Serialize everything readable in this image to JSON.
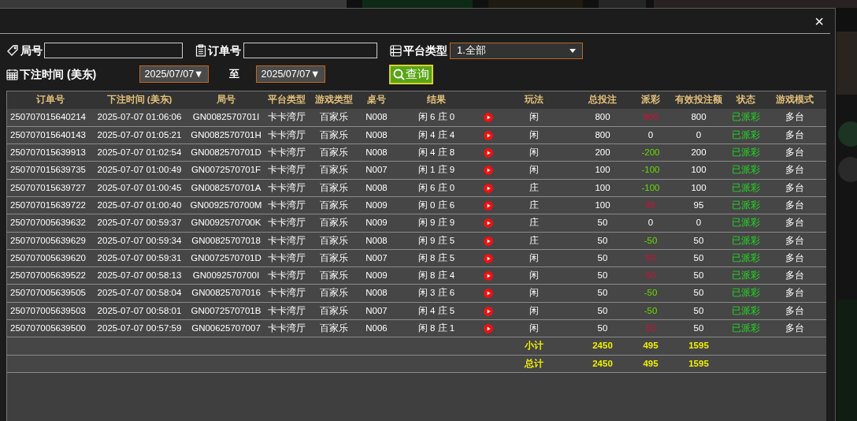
{
  "dialog": {
    "close": "×"
  },
  "filters": {
    "round_no": {
      "label": "局号"
    },
    "order_no": {
      "label": "订单号"
    },
    "platform": {
      "label": "平台类型",
      "value": "1.全部"
    },
    "bet_time": {
      "label": "下注时间 (美东)",
      "from": "2025/07/07▼",
      "separator": "至",
      "to": "2025/07/07▼"
    },
    "search_button": "查询"
  },
  "table": {
    "columns": [
      "订单号",
      "下注时间 (美东)",
      "局号",
      "平台类型",
      "游戏类型",
      "桌号",
      "结果",
      "玩法",
      "总投注",
      "派彩",
      "有效投注额",
      "状态",
      "游戏模式"
    ],
    "rows": [
      {
        "order": "250707015640214",
        "time": "2025-07-07 01:06:06",
        "round": "GN0082570701I",
        "platform": "卡卡湾厅",
        "game": "百家乐",
        "table": "N008",
        "result": "闲 6 庄 0",
        "play": "闲",
        "bet": "800",
        "payout": {
          "text": "800",
          "kind": "positive"
        },
        "valid": "800",
        "status": "已派彩",
        "mode": "多台"
      },
      {
        "order": "250707015640143",
        "time": "2025-07-07 01:05:21",
        "round": "GN0082570701H",
        "platform": "卡卡湾厅",
        "game": "百家乐",
        "table": "N008",
        "result": "闲 4 庄 4",
        "play": "闲",
        "bet": "800",
        "payout": {
          "text": "0",
          "kind": "zero"
        },
        "valid": "0",
        "status": "已派彩",
        "mode": "多台"
      },
      {
        "order": "250707015639913",
        "time": "2025-07-07 01:02:54",
        "round": "GN0082570701D",
        "platform": "卡卡湾厅",
        "game": "百家乐",
        "table": "N008",
        "result": "闲 4 庄 8",
        "play": "闲",
        "bet": "200",
        "payout": {
          "text": "-200",
          "kind": "negative"
        },
        "valid": "200",
        "status": "已派彩",
        "mode": "多台"
      },
      {
        "order": "250707015639735",
        "time": "2025-07-07 01:00:49",
        "round": "GN0072570701F",
        "platform": "卡卡湾厅",
        "game": "百家乐",
        "table": "N007",
        "result": "闲 1 庄 9",
        "play": "闲",
        "bet": "100",
        "payout": {
          "text": "-100",
          "kind": "negative"
        },
        "valid": "100",
        "status": "已派彩",
        "mode": "多台"
      },
      {
        "order": "250707015639727",
        "time": "2025-07-07 01:00:45",
        "round": "GN0082570701A",
        "platform": "卡卡湾厅",
        "game": "百家乐",
        "table": "N008",
        "result": "闲 6 庄 0",
        "play": "庄",
        "bet": "100",
        "payout": {
          "text": "-100",
          "kind": "negative"
        },
        "valid": "100",
        "status": "已派彩",
        "mode": "多台"
      },
      {
        "order": "250707015639722",
        "time": "2025-07-07 01:00:40",
        "round": "GN0092570700M",
        "platform": "卡卡湾厅",
        "game": "百家乐",
        "table": "N009",
        "result": "闲 0 庄 6",
        "play": "庄",
        "bet": "100",
        "payout": {
          "text": "95",
          "kind": "positive"
        },
        "valid": "95",
        "status": "已派彩",
        "mode": "多台"
      },
      {
        "order": "250707005639632",
        "time": "2025-07-07 00:59:37",
        "round": "GN0092570700K",
        "platform": "卡卡湾厅",
        "game": "百家乐",
        "table": "N009",
        "result": "闲 9 庄 9",
        "play": "庄",
        "bet": "50",
        "payout": {
          "text": "0",
          "kind": "zero"
        },
        "valid": "0",
        "status": "已派彩",
        "mode": "多台"
      },
      {
        "order": "250707005639629",
        "time": "2025-07-07 00:59:34",
        "round": "GN00825707018",
        "platform": "卡卡湾厅",
        "game": "百家乐",
        "table": "N008",
        "result": "闲 9 庄 5",
        "play": "庄",
        "bet": "50",
        "payout": {
          "text": "-50",
          "kind": "negative"
        },
        "valid": "50",
        "status": "已派彩",
        "mode": "多台"
      },
      {
        "order": "250707005639620",
        "time": "2025-07-07 00:59:31",
        "round": "GN0072570701D",
        "platform": "卡卡湾厅",
        "game": "百家乐",
        "table": "N007",
        "result": "闲 8 庄 5",
        "play": "闲",
        "bet": "50",
        "payout": {
          "text": "50",
          "kind": "positive"
        },
        "valid": "50",
        "status": "已派彩",
        "mode": "多台"
      },
      {
        "order": "250707005639522",
        "time": "2025-07-07 00:58:13",
        "round": "GN0092570700I",
        "platform": "卡卡湾厅",
        "game": "百家乐",
        "table": "N009",
        "result": "闲 8 庄 4",
        "play": "闲",
        "bet": "50",
        "payout": {
          "text": "50",
          "kind": "positive"
        },
        "valid": "50",
        "status": "已派彩",
        "mode": "多台"
      },
      {
        "order": "250707005639505",
        "time": "2025-07-07 00:58:04",
        "round": "GN00825707016",
        "platform": "卡卡湾厅",
        "game": "百家乐",
        "table": "N008",
        "result": "闲 3 庄 6",
        "play": "闲",
        "bet": "50",
        "payout": {
          "text": "-50",
          "kind": "negative"
        },
        "valid": "50",
        "status": "已派彩",
        "mode": "多台"
      },
      {
        "order": "250707005639503",
        "time": "2025-07-07 00:58:01",
        "round": "GN0072570701B",
        "platform": "卡卡湾厅",
        "game": "百家乐",
        "table": "N007",
        "result": "闲 4 庄 5",
        "play": "闲",
        "bet": "50",
        "payout": {
          "text": "-50",
          "kind": "negative"
        },
        "valid": "50",
        "status": "已派彩",
        "mode": "多台"
      },
      {
        "order": "250707005639500",
        "time": "2025-07-07 00:57:59",
        "round": "GN00625707007",
        "platform": "卡卡湾厅",
        "game": "百家乐",
        "table": "N006",
        "result": "闲 8 庄 1",
        "play": "闲",
        "bet": "50",
        "payout": {
          "text": "50",
          "kind": "positive"
        },
        "valid": "50",
        "status": "已派彩",
        "mode": "多台"
      }
    ],
    "totals": [
      {
        "label": "小计",
        "bet": "2450",
        "payout": "495",
        "valid": "1595"
      },
      {
        "label": "总计",
        "bet": "2450",
        "payout": "495",
        "valid": "1595"
      }
    ]
  }
}
